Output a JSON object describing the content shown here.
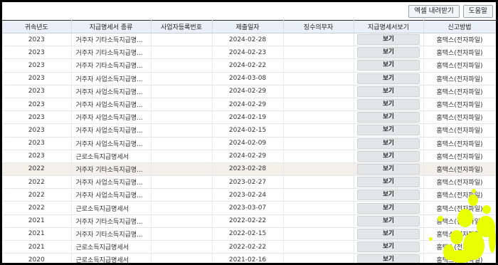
{
  "toolbar": {
    "excel_label": "엑셀 내려받기",
    "help_label": "도움말"
  },
  "table": {
    "headers": [
      "귀속년도",
      "지급명세서 종류",
      "사업자등록번호",
      "제출일자",
      "징수의무자",
      "지급명세서보기",
      "신고방법"
    ],
    "rows": [
      {
        "year": "2023",
        "kind": "거주자 기타소득지급명...",
        "bizno": "",
        "date": "2024-02-28",
        "payer": "",
        "view": "보기",
        "method": "홈택스(전자파일)"
      },
      {
        "year": "2023",
        "kind": "거주자 기타소득지급명...",
        "bizno": "",
        "date": "2024-02-23",
        "payer": "",
        "view": "보기",
        "method": "홈택스(전자파일)"
      },
      {
        "year": "2023",
        "kind": "거주자 기타소득지급명...",
        "bizno": "",
        "date": "2024-02-22",
        "payer": "",
        "view": "보기",
        "method": "홈택스(전자파일)"
      },
      {
        "year": "2023",
        "kind": "거주자 사업소득지급명...",
        "bizno": "",
        "date": "2024-03-08",
        "payer": "",
        "view": "보기",
        "method": "홈택스(전자파일)"
      },
      {
        "year": "2023",
        "kind": "거주자 사업소득지급명...",
        "bizno": "",
        "date": "2024-02-29",
        "payer": "",
        "view": "보기",
        "method": "홈택스(전자파일)"
      },
      {
        "year": "2023",
        "kind": "거주자 사업소득지급명...",
        "bizno": "",
        "date": "2024-02-29",
        "payer": "",
        "view": "보기",
        "method": "홈택스(전자파일)"
      },
      {
        "year": "2023",
        "kind": "거주자 사업소득지급명...",
        "bizno": "",
        "date": "2024-02-19",
        "payer": "",
        "view": "보기",
        "method": "홈택스(전자파일)"
      },
      {
        "year": "2023",
        "kind": "거주자 사업소득지급명...",
        "bizno": "",
        "date": "2024-02-15",
        "payer": "",
        "view": "보기",
        "method": "홈택스(전자파일)"
      },
      {
        "year": "2023",
        "kind": "거주자 사업소득지급명...",
        "bizno": "",
        "date": "2024-02-09",
        "payer": "",
        "view": "보기",
        "method": "홈택스(전자파일)"
      },
      {
        "year": "2023",
        "kind": "근로소득지급명세서",
        "bizno": "",
        "date": "2024-02-29",
        "payer": "",
        "view": "보기",
        "method": "홈택스(전자파일)"
      },
      {
        "year": "2022",
        "kind": "거주자 기타소득지급명...",
        "bizno": "",
        "date": "2023-02-28",
        "payer": "",
        "view": "보기",
        "method": "홈택스(전자파일)"
      },
      {
        "year": "2022",
        "kind": "거주자 사업소득지급명...",
        "bizno": "",
        "date": "2023-02-27",
        "payer": "",
        "view": "보기",
        "method": "홈택스(전자파일)"
      },
      {
        "year": "2022",
        "kind": "거주자 사업소득지급명...",
        "bizno": "",
        "date": "2023-02-24",
        "payer": "",
        "view": "보기",
        "method": "홈택스(전자파일)"
      },
      {
        "year": "2022",
        "kind": "근로소득지급명세서",
        "bizno": "",
        "date": "2023-03-07",
        "payer": "",
        "view": "보기",
        "method": "홈택스(전자파일)"
      },
      {
        "year": "2021",
        "kind": "거주자 기타소득지급명...",
        "bizno": "",
        "date": "2022-02-22",
        "payer": "",
        "view": "보기",
        "method": "홈택스(전자파일)"
      },
      {
        "year": "2021",
        "kind": "거주자 기타소득지급명...",
        "bizno": "",
        "date": "2022-02-15",
        "payer": "",
        "view": "보기",
        "method": "홈택스(전자파일)"
      },
      {
        "year": "2021",
        "kind": "근로소득지급명세서",
        "bizno": "",
        "date": "2022-02-22",
        "payer": "",
        "view": "보기",
        "method": "홈택스(전자파일)"
      },
      {
        "year": "2020",
        "kind": "근로소득지급명세서",
        "bizno": "",
        "date": "2021-02-16",
        "payer": "",
        "view": "보기",
        "method": "홈택스(전자파일)"
      }
    ],
    "highlighted_row": 10
  },
  "colors": {
    "header_bg": "#eaf0f7",
    "highlight_bg": "#f4efe9",
    "button_bg": "#e4e5e7",
    "splatter": "#e8ff00"
  }
}
